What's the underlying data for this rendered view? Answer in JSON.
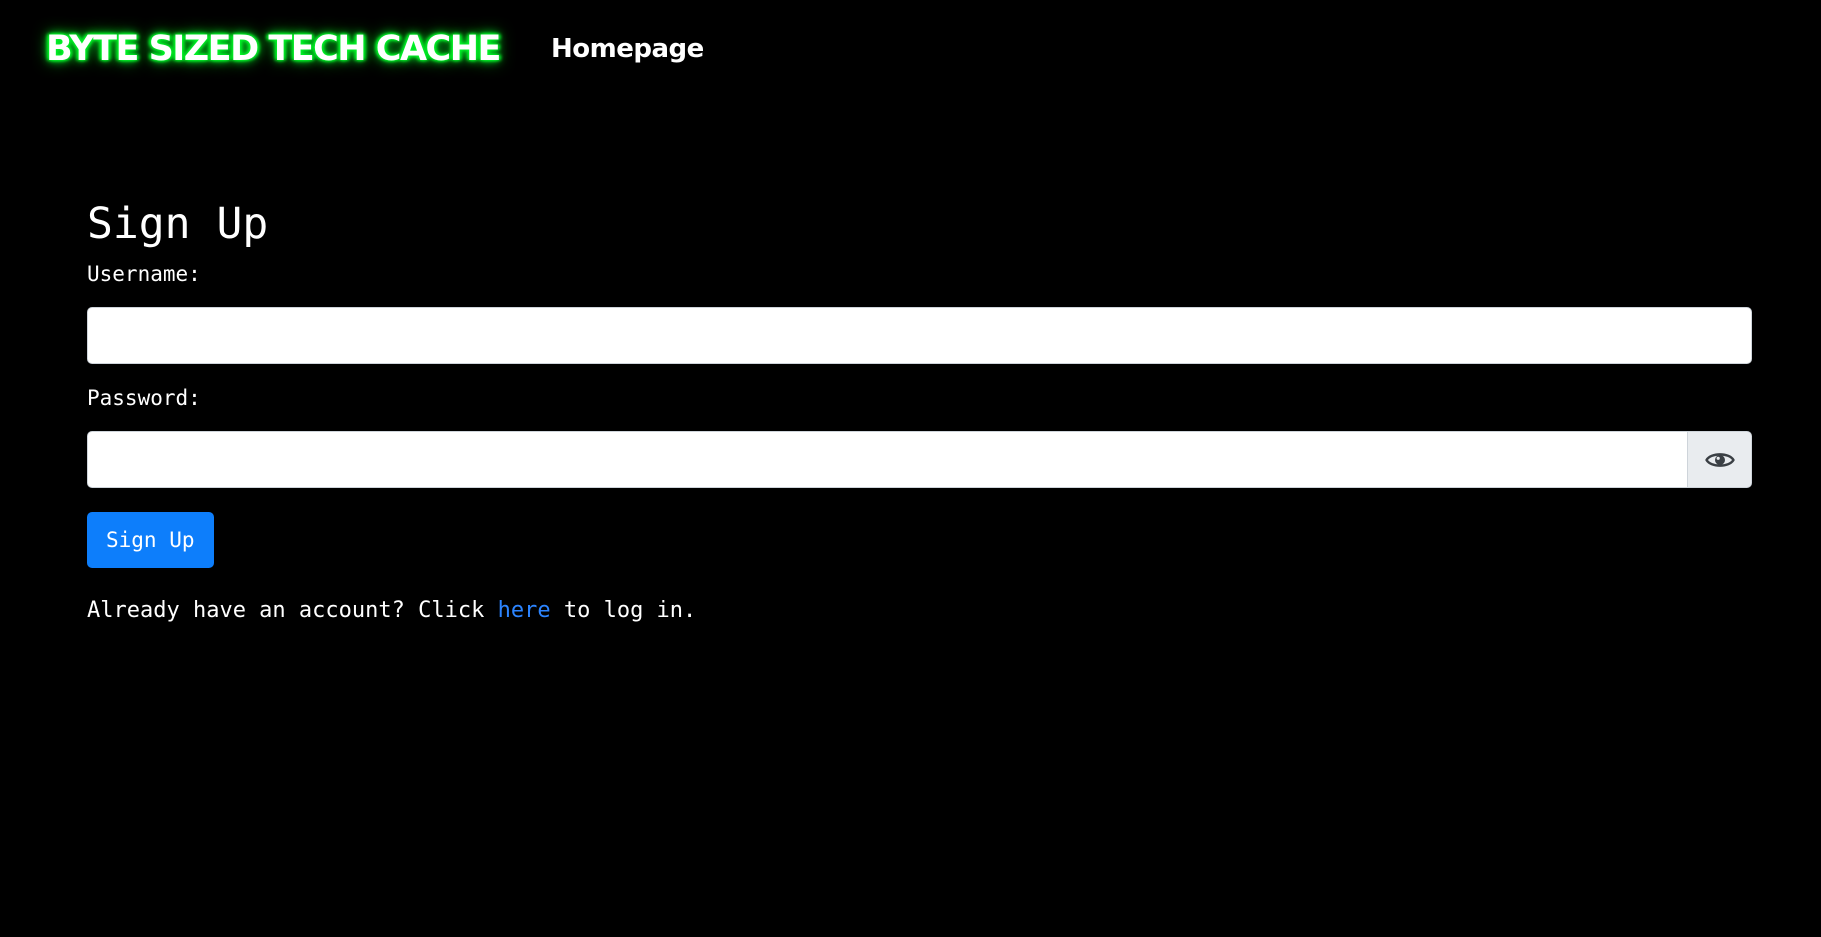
{
  "nav": {
    "brand": "BYTE SIZED TECH  CACHE",
    "home_link": "Homepage"
  },
  "form": {
    "title": "Sign Up",
    "username_label": "Username:",
    "username_value": "",
    "password_label": "Password:",
    "password_value": "",
    "toggle_icon": "eye-icon",
    "submit_label": "Sign Up"
  },
  "login_prompt": {
    "before": "Already have an account? Click ",
    "link_text": "here",
    "after": " to log in."
  },
  "colors": {
    "background": "#000000",
    "brand_glow": "#00ff2a",
    "primary": "#0d7efb",
    "link": "#2c84ff"
  }
}
